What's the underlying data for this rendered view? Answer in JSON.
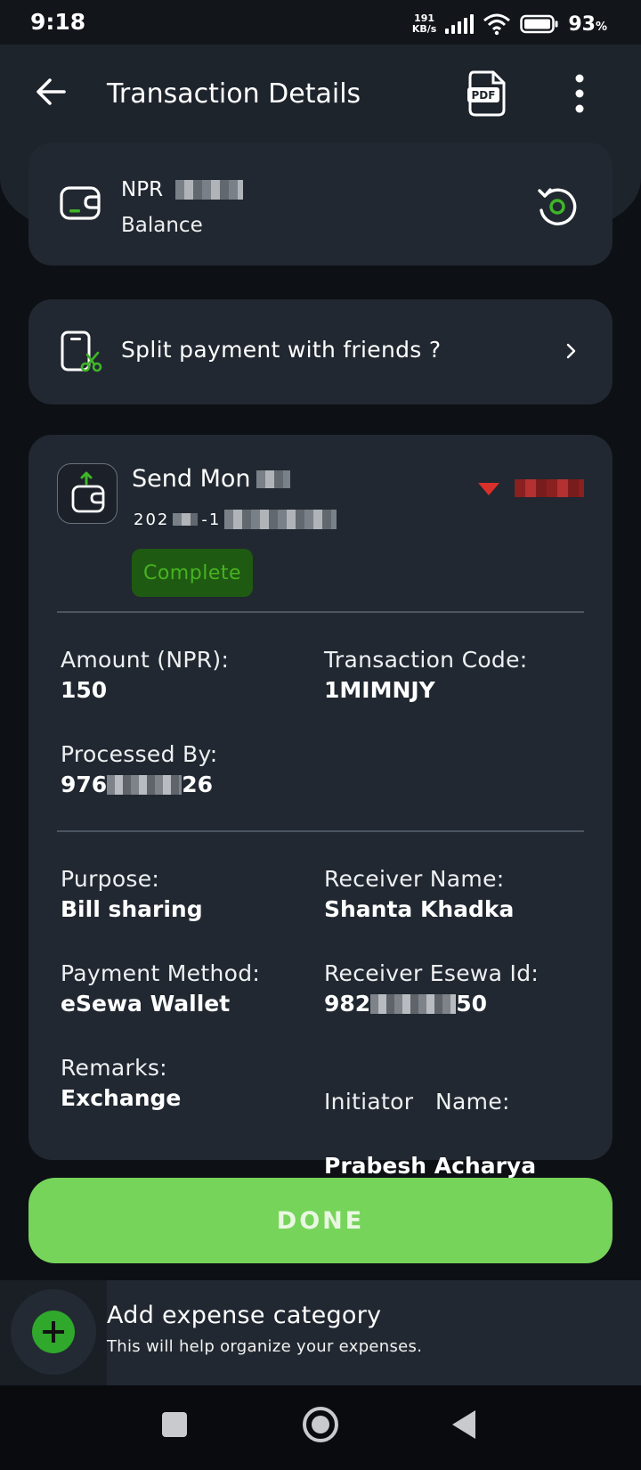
{
  "status_bar": {
    "time": "9:18",
    "net_speed_value": "191",
    "net_speed_unit": "KB/s",
    "battery_percent": "93",
    "battery_unit": "%"
  },
  "header": {
    "title": "Transaction Details",
    "pdf_label": "PDF"
  },
  "balance": {
    "currency": "NPR",
    "label": "Balance"
  },
  "split": {
    "label": "Split payment with friends ?"
  },
  "transaction": {
    "type": "Send Mon",
    "date_prefix": "202",
    "date_mid": "-1",
    "status": "Complete",
    "fields": {
      "amount_label": "Amount (NPR):",
      "amount_value": "150",
      "code_label": "Transaction Code:",
      "code_value": "1MIMNJY",
      "processed_label": "Processed By:",
      "processed_prefix": "976",
      "processed_suffix": "26",
      "purpose_label": "Purpose:",
      "purpose_value": "Bill sharing",
      "receiver_name_label": "Receiver Name:",
      "receiver_name_value": "Shanta Khadka",
      "method_label": "Payment Method:",
      "method_value": "eSewa Wallet",
      "receiver_id_label": "Receiver Esewa Id:",
      "receiver_id_prefix": "982",
      "receiver_id_suffix": "50",
      "remarks_label": "Remarks:",
      "remarks_value": "Exchange",
      "initiator_label": "Initiator   Name:",
      "initiator_value": "Prabesh Acharya"
    }
  },
  "done_button": "DONE",
  "expense": {
    "title": "Add expense category",
    "subtitle": "This will help organize your expenses."
  },
  "colors": {
    "accent_green": "#76d45a",
    "status_green": "#46b321",
    "debit_red": "#d9302c",
    "card_bg": "#212831"
  }
}
